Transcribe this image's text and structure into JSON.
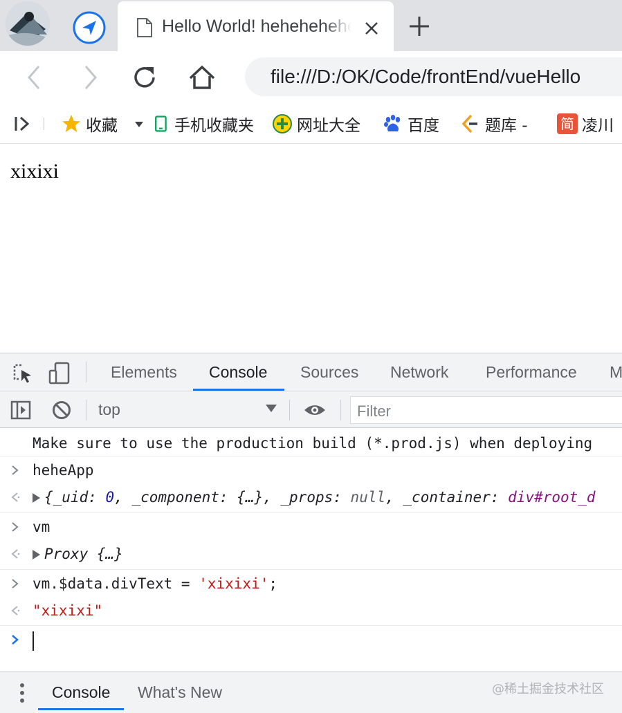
{
  "browser": {
    "tab": {
      "title": "Hello World! hehehehehe",
      "close_label": "×"
    },
    "address": "file:///D:/OK/Code/frontEnd/vueHello",
    "bookmarks": [
      {
        "label": "收藏"
      },
      {
        "label": "手机收藏夹"
      },
      {
        "label": "网址大全"
      },
      {
        "label": "百度"
      },
      {
        "label": "题库 -"
      },
      {
        "label": "凌川"
      }
    ],
    "bookmark_icon_chars": {
      "jian": "简"
    }
  },
  "page": {
    "text": "xixixi"
  },
  "devtools": {
    "tabs": [
      "Elements",
      "Console",
      "Sources",
      "Network",
      "Performance",
      "M"
    ],
    "active_tab": "Console",
    "context": "top",
    "filter_placeholder": "Filter",
    "console": {
      "warning_line": "Make sure to use the production build (*.prod.js) when deploying",
      "entries": [
        {
          "input": "heheApp",
          "output_parts": [
            "{_uid: ",
            "0",
            ", _component: {…}, _props: ",
            "null",
            ", _container: ",
            "div#root_d"
          ]
        },
        {
          "input": "vm",
          "output": "Proxy {…}"
        },
        {
          "input_prefix": "vm.$data.divText = ",
          "input_string": "'xixixi'",
          "input_suffix": ";",
          "output": "\"xixixi\""
        }
      ]
    },
    "drawer_tabs": [
      "Console",
      "What's New"
    ],
    "watermark": "@稀土掘金技术社区"
  }
}
